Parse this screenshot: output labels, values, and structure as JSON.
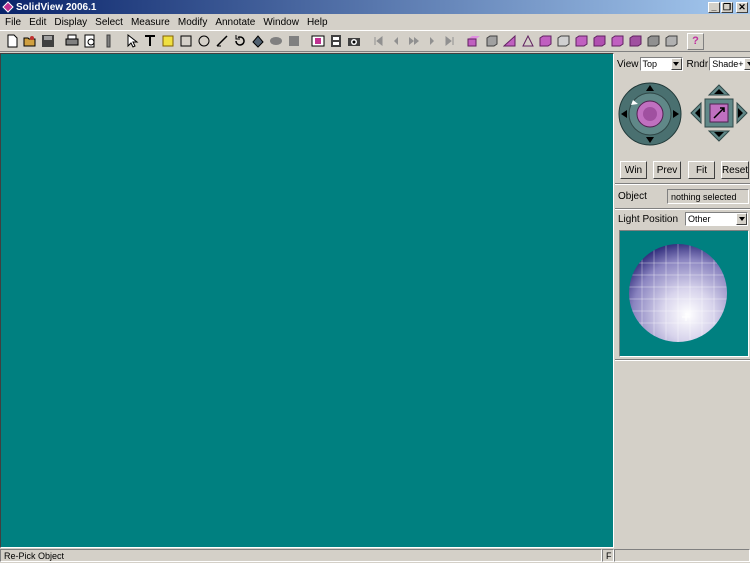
{
  "window": {
    "title": "SolidView 2006.1"
  },
  "window_controls": {
    "minimize": "_",
    "restore": "❐",
    "close": "✕"
  },
  "menu": [
    "File",
    "Edit",
    "Display",
    "Select",
    "Measure",
    "Modify",
    "Annotate",
    "Window",
    "Help"
  ],
  "toolbar": {
    "groups": [
      [
        "new-file-icon",
        "open-folder-icon",
        "save-icon",
        "print-icon",
        "print-preview-icon",
        "pipe-icon"
      ],
      [
        "select-arrow-icon",
        "text-tool-icon",
        "yellow-note-icon",
        "rectangle-icon",
        "circle-icon",
        "line-icon",
        "rotate-icon",
        "shape-icon",
        "ellipse-icon",
        "square-fill-icon"
      ],
      [
        "snapshot-icon",
        "film-icon",
        "camera-icon"
      ],
      [
        "first-frame-icon",
        "prev-frame-icon",
        "fast-forward-icon",
        "next-frame-icon",
        "last-frame-icon"
      ],
      [
        "view-front-icon",
        "view-back-icon",
        "view-iso-icon",
        "view-left-icon",
        "view-right-icon",
        "view-top-icon",
        "view-bottom-icon",
        "view-persp-icon",
        "view-fit-icon",
        "view-shade-icon",
        "view-wire-icon",
        "view-hidden-icon"
      ]
    ],
    "help_label": "?"
  },
  "panel": {
    "view_label": "View",
    "view_value": "Top",
    "render_label": "Rndr",
    "render_value": "Shade+F..",
    "buttons": {
      "win": "Win",
      "prev": "Prev",
      "fit": "Fit",
      "reset": "Reset"
    },
    "object_label": "Object",
    "object_value": "nothing selected",
    "light_label": "Light Position",
    "light_value": "Other"
  },
  "status": {
    "message": "Re-Pick Object",
    "indicator": "F"
  },
  "colors": {
    "viewport": "#008080",
    "title_start": "#0a246a",
    "title_end": "#a6caf0",
    "accent_pink": "#c060c0"
  }
}
